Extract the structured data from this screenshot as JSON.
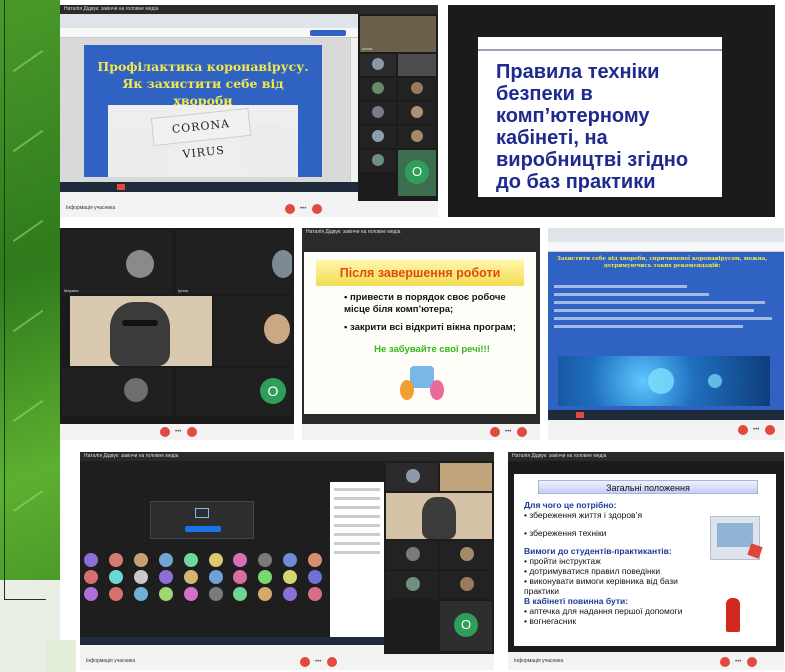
{
  "screen1": {
    "topbar": "Наталія Дідвук: закінчи на головне медіа",
    "slide_title": "Профілактика коронавірусу. Як захистити себе від хвороби",
    "card_text": "CORONA VIRUS",
    "bottom_label": "Інформація учасника"
  },
  "screen2": {
    "slide_text": "Правила техніки безпеки в комп’ютерному кабінеті, на виробництві згідно до баз практики"
  },
  "screen3": {
    "bottom_label": "",
    "avatar_letter": "O"
  },
  "screen4": {
    "topbar": "Наталія Дідвук: закінчи на головне медіа",
    "title": "Після завершення роботи",
    "items": [
      "привести в порядок своє робоче місце біля комп’ютера;",
      "закрити всі відкриті вікна програм;"
    ],
    "reminder": "Не забувайте свої речі!!!"
  },
  "screen5": {
    "slide_text": "Захистити себе від хвороби, спричиненої коронавірусом, можна, дотримуючись таких рекомендацій:"
  },
  "screen6": {
    "topbar": "Наталія Дідвук: закінчи на головне медіа",
    "avatar_letter": "O",
    "bottom_label": "Інформація учасника"
  },
  "screen7": {
    "topbar": "Наталія Дідвук: закінчи на головне медіа"
  },
  "screen8": {
    "title": "Загальні положення",
    "head1": "Для чого це потрібно:",
    "items1": [
      "збереження життя і здоров’я",
      "збереження техніки"
    ],
    "head2": "Вимоги до студентів-практикантів:",
    "items2": [
      "пройти інструктаж",
      "дотримуватися правил поведінки",
      "виконувати вимоги керівника від бази практики"
    ],
    "head3": "В кабінеті повинна бути:",
    "items3": [
      "аптечка для надання першої допомоги",
      "вогнегасник"
    ],
    "bottom_label": "Інформація учасника"
  },
  "colors": {
    "zoom_red": "#e04a3f",
    "slide_blue": "#2f62c2",
    "title_yellow": "#f3e84a",
    "rule_blue": "#1e2a8f",
    "orange": "#e44a12",
    "green": "#34b81a"
  }
}
